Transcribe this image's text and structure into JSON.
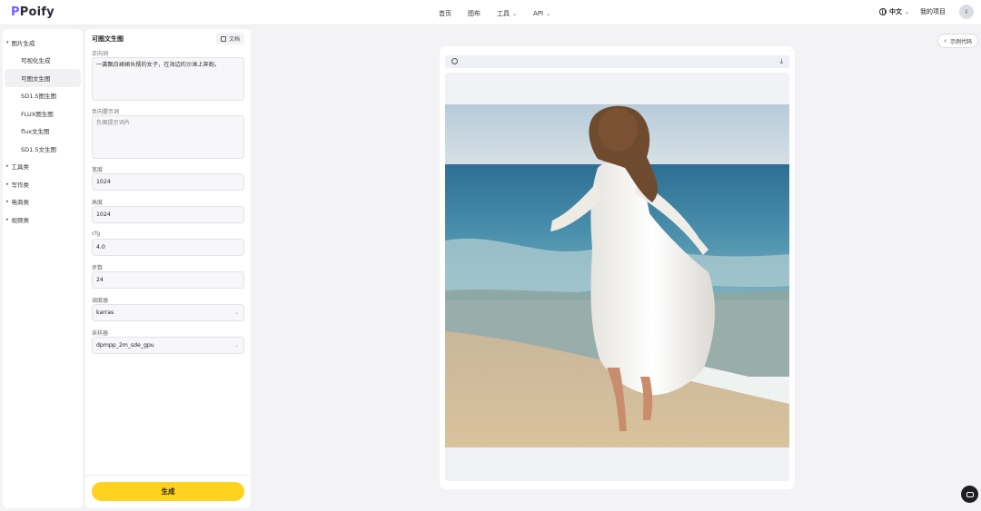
{
  "app": {
    "logo_text": "Poify"
  },
  "nav": {
    "home": "首页",
    "gallery": "图布",
    "tools": "工具",
    "api": "API"
  },
  "header": {
    "lang": "中文",
    "my_projects": "我的项目",
    "avatar_initial": "li"
  },
  "sidebar": {
    "group_image_gen": "图片生成",
    "items": [
      "可视化生成",
      "可图文生图",
      "SD1.5图生图",
      "FLUX图生图",
      "flux文生图",
      "SD1.5文生图"
    ],
    "active_index": 1,
    "groups": [
      "工具类",
      "写作类",
      "电商类",
      "视频类"
    ]
  },
  "panel": {
    "title": "可图文生图",
    "doc_button": "文档",
    "prompt_label": "正向词",
    "prompt_value": "一袭飘白裙裙长摆的女子，在海边的沙滩上奔跑。",
    "negative_label": "负向提示词",
    "negative_placeholder": "负面提示词片",
    "width_label": "宽度",
    "width_value": "1024",
    "height_label": "高度",
    "height_value": "1024",
    "cfg_label": "cfg",
    "cfg_value": "4.0",
    "steps_label": "步数",
    "steps_value": "24",
    "scheduler_label": "调度器",
    "scheduler_value": "karras",
    "sampler_label": "采样器",
    "sampler_value": "dpmpp_2m_sde_gpu",
    "generate_button": "生成"
  },
  "preview": {
    "show_code": "示例代码"
  },
  "colors": {
    "accent": "#ffd21f",
    "logo_p": "#7b5cff",
    "page_bg": "#f3f3f5"
  }
}
